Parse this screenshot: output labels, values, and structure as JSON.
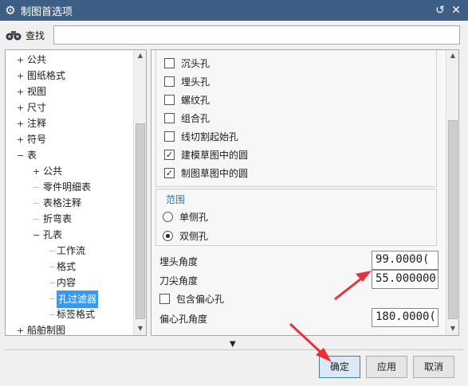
{
  "window": {
    "title": "制图首选项"
  },
  "search": {
    "label": "查找",
    "value": ""
  },
  "tree": {
    "items": [
      {
        "label": "公共",
        "expander": "+",
        "level": 0
      },
      {
        "label": "图纸格式",
        "expander": "+",
        "level": 0
      },
      {
        "label": "视图",
        "expander": "+",
        "level": 0
      },
      {
        "label": "尺寸",
        "expander": "+",
        "level": 0
      },
      {
        "label": "注释",
        "expander": "+",
        "level": 0
      },
      {
        "label": "符号",
        "expander": "+",
        "level": 0
      },
      {
        "label": "表",
        "expander": "-",
        "level": 0
      },
      {
        "label": "公共",
        "expander": "+",
        "level": 1
      },
      {
        "label": "零件明细表",
        "expander": "",
        "level": 1
      },
      {
        "label": "表格注释",
        "expander": "",
        "level": 1
      },
      {
        "label": "折弯表",
        "expander": "",
        "level": 1
      },
      {
        "label": "孔表",
        "expander": "-",
        "level": 1
      },
      {
        "label": "工作流",
        "expander": "",
        "level": 2
      },
      {
        "label": "格式",
        "expander": "",
        "level": 2
      },
      {
        "label": "内容",
        "expander": "",
        "level": 2
      },
      {
        "label": "孔过滤器",
        "expander": "",
        "level": 2,
        "selected": true
      },
      {
        "label": "标签格式",
        "expander": "",
        "level": 2
      },
      {
        "label": "船舶制图",
        "expander": "+",
        "level": 0
      }
    ]
  },
  "filters": {
    "checkboxes": [
      {
        "label": "沉头孔",
        "checked": false
      },
      {
        "label": "埋头孔",
        "checked": false
      },
      {
        "label": "螺纹孔",
        "checked": false
      },
      {
        "label": "组合孔",
        "checked": false
      },
      {
        "label": "线切割起始孔",
        "checked": false
      },
      {
        "label": "建模草图中的圆",
        "checked": true
      },
      {
        "label": "制图草图中的圆",
        "checked": true
      }
    ],
    "range": {
      "title": "范围",
      "options": [
        {
          "label": "单侧孔",
          "selected": false
        },
        {
          "label": "双侧孔",
          "selected": true
        }
      ]
    },
    "countersink_angle": {
      "label": "埋头角度",
      "value": "99.0000("
    },
    "drill_point_angle": {
      "label": "刀尖角度",
      "value": "55.000000"
    },
    "include_eccentric": {
      "label": "包含偏心孔",
      "checked": false
    },
    "eccentric_angle": {
      "label": "偏心孔角度",
      "value": "180.0000("
    }
  },
  "buttons": {
    "ok": "确定",
    "apply": "应用",
    "cancel": "取消"
  },
  "colors": {
    "titlebar": "#3d5f86",
    "selection": "#3399ff",
    "annotation_arrow": "#e8303a"
  },
  "icons": {
    "title": "gear-icon",
    "search": "binoculars-icon",
    "reset": "reset-icon",
    "close": "close-icon"
  }
}
